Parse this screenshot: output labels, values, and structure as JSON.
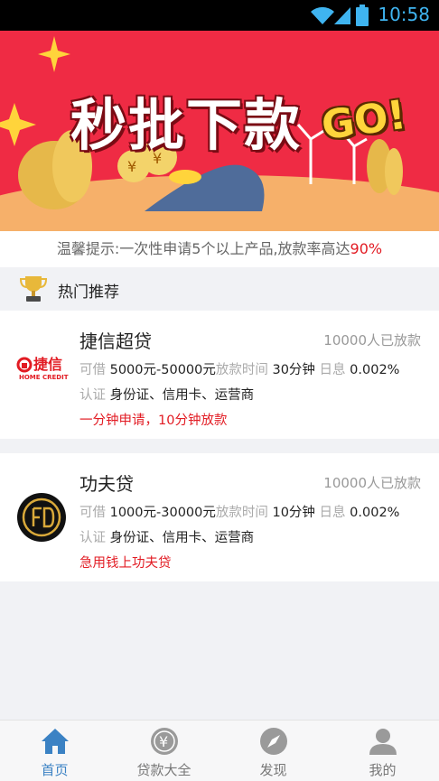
{
  "status_bar": {
    "time": "10:58"
  },
  "banner": {
    "title": "秒批下款",
    "go_text": "GO!"
  },
  "notice": {
    "text": "温馨提示:一次性申请5个以上产品,放款率高达",
    "highlight": "90%"
  },
  "section": {
    "title": "热门推荐"
  },
  "products": [
    {
      "name": "捷信超贷",
      "borrowers": "10000人已放款",
      "amount_label": "可借",
      "amount": "5000元-50000元",
      "time_label": "放款时间",
      "time": "30分钟",
      "rate_label": "日息",
      "rate": "0.002%",
      "cert_label": "认证",
      "cert": "身份证、信用卡、运营商",
      "slogan": "一分钟申请，10分钟放款",
      "logo_text": "捷信",
      "logo_sub": "HOME CREDIT"
    },
    {
      "name": "功夫贷",
      "borrowers": "10000人已放款",
      "amount_label": "可借",
      "amount": "1000元-30000元",
      "time_label": "放款时间",
      "time": "10分钟",
      "rate_label": "日息",
      "rate": "0.002%",
      "cert_label": "认证",
      "cert": "身份证、信用卡、运营商",
      "slogan": "急用钱上功夫贷"
    }
  ],
  "tabs": [
    {
      "label": "首页",
      "icon": "home-icon",
      "active": true
    },
    {
      "label": "贷款大全",
      "icon": "yen-coin-icon",
      "active": false
    },
    {
      "label": "发现",
      "icon": "compass-icon",
      "active": false
    },
    {
      "label": "我的",
      "icon": "user-icon",
      "active": false
    }
  ],
  "colors": {
    "accent": "#3b82c4",
    "highlight": "#e21b23",
    "banner": "#ef2b44"
  }
}
